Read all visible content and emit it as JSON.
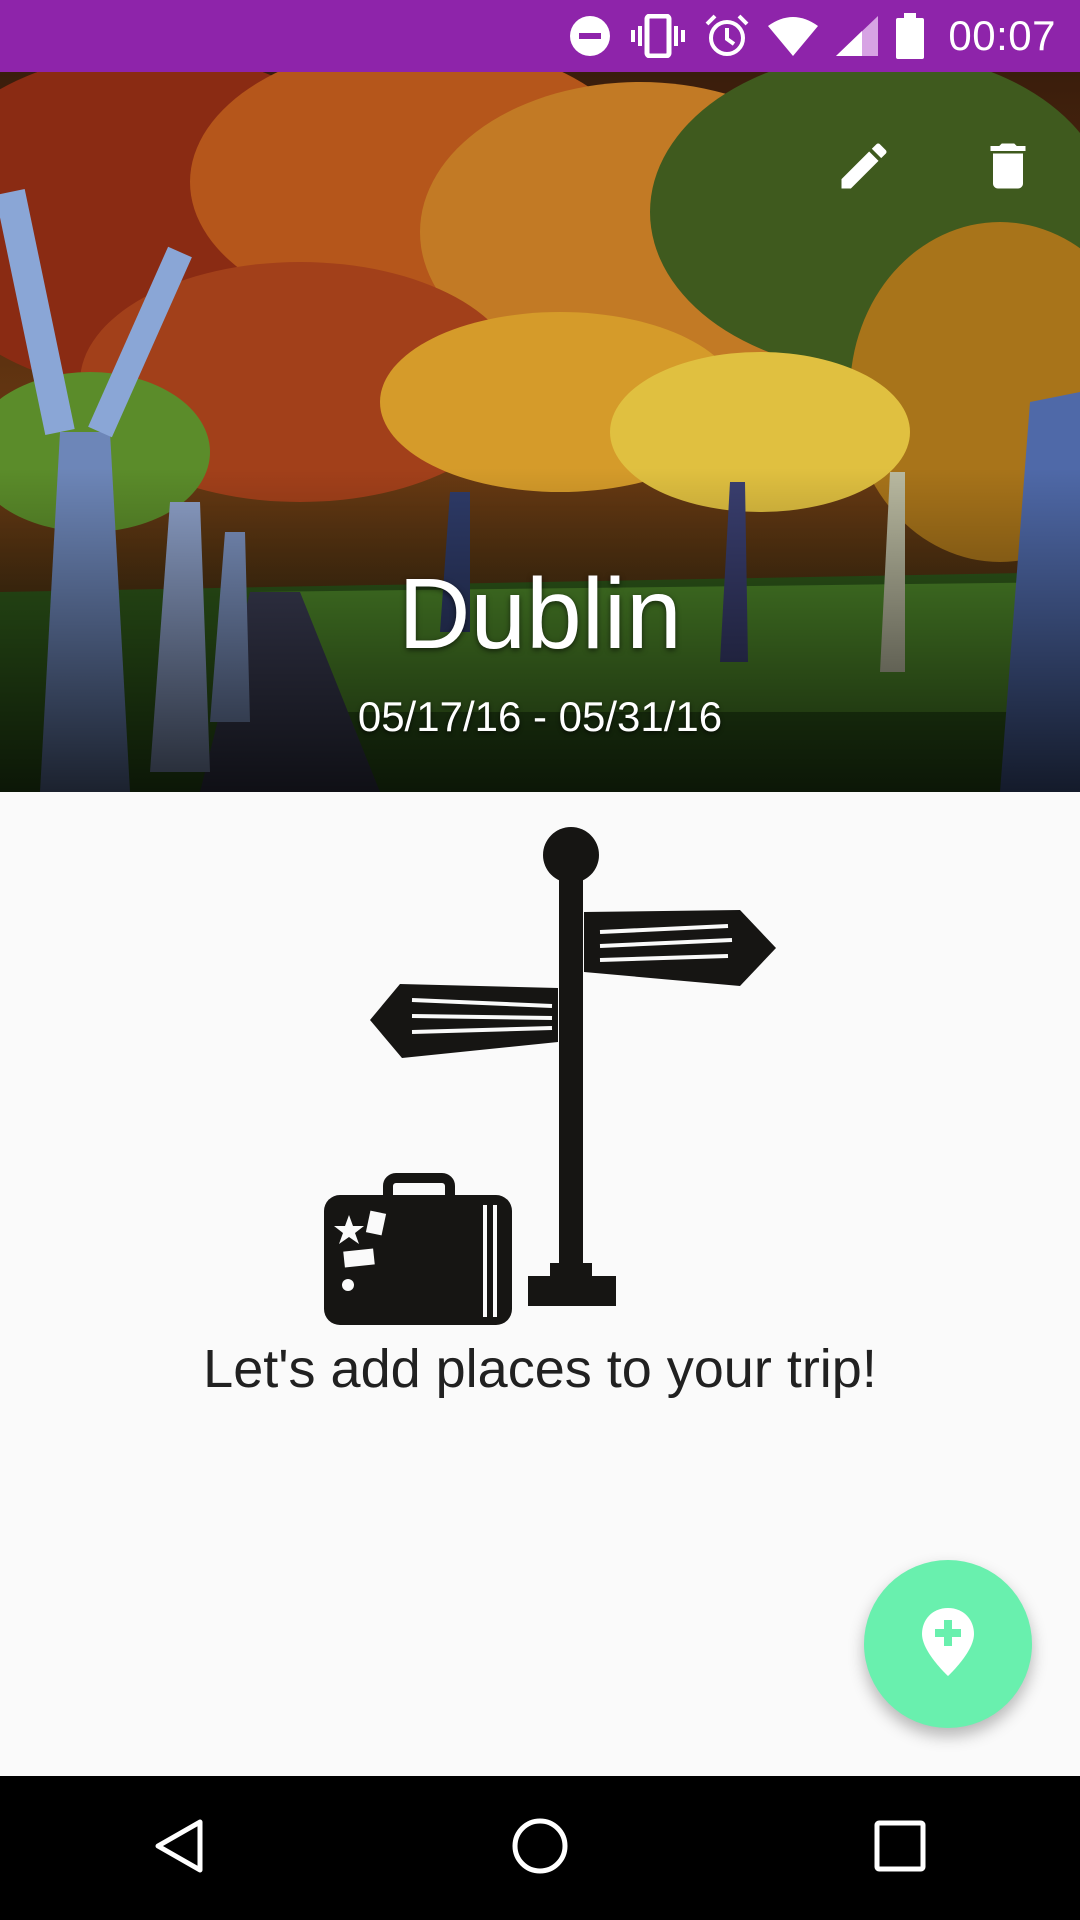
{
  "status_bar": {
    "time": "00:07",
    "icons": [
      "do-not-disturb-icon",
      "vibrate-icon",
      "alarm-icon",
      "wifi-icon",
      "cell-signal-icon",
      "battery-icon"
    ],
    "background": "#8e24aa"
  },
  "trip": {
    "title": "Dublin",
    "dates": "05/17/16 - 05/31/16"
  },
  "actions": {
    "edit_icon": "pencil-icon",
    "delete_icon": "trash-icon"
  },
  "empty_state": {
    "message": "Let's add places to your trip!",
    "illustration": "signpost-with-suitcase"
  },
  "fab": {
    "icon": "add-location-icon",
    "color": "#69f0ae"
  },
  "nav_bar": {
    "icons": [
      "back-icon",
      "home-icon",
      "recents-icon"
    ]
  }
}
